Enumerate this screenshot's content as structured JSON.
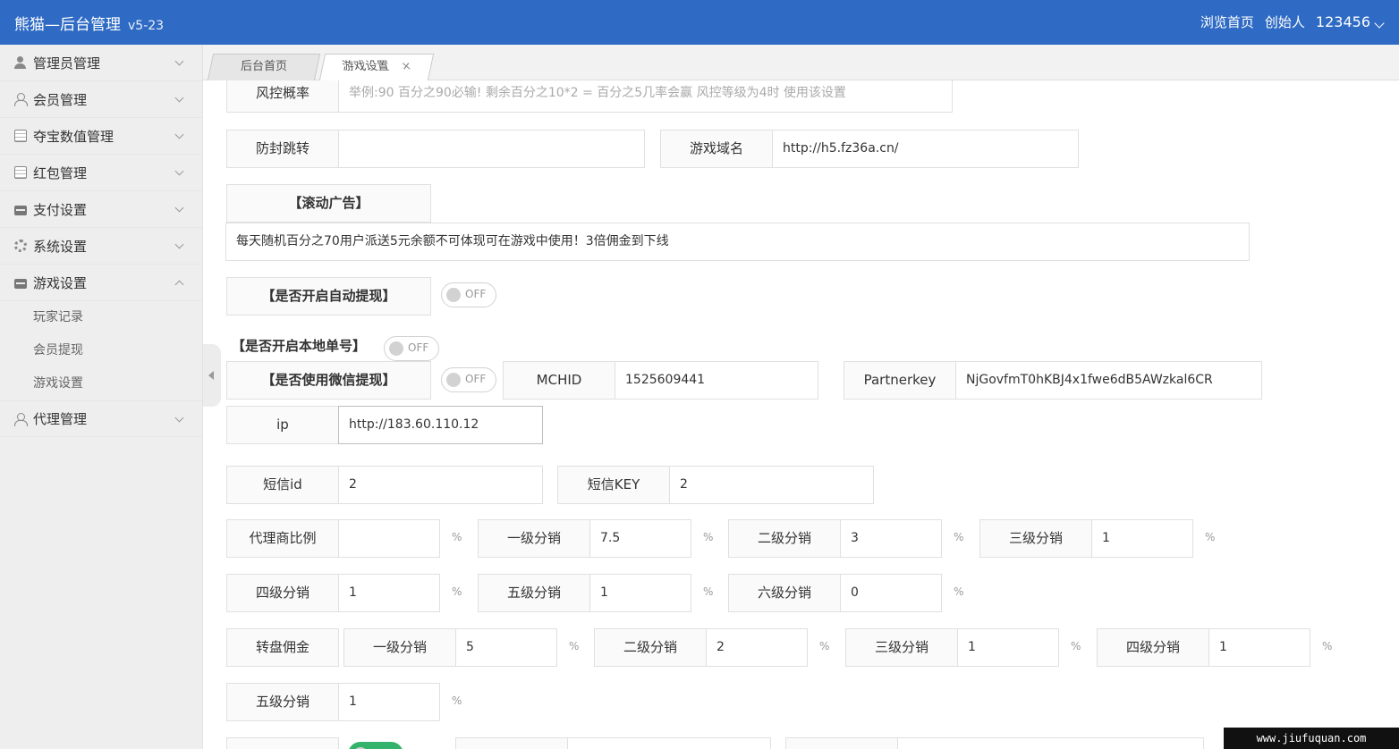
{
  "header": {
    "brand": "熊猫—后台管理",
    "version": "v5-23",
    "links": [
      "浏览首页",
      "创始人",
      "123456"
    ]
  },
  "sidebar": {
    "items": [
      {
        "label": "管理员管理",
        "icon": "user-icon"
      },
      {
        "label": "会员管理",
        "icon": "user-outline-icon"
      },
      {
        "label": "夺宝数值管理",
        "icon": "document-icon"
      },
      {
        "label": "红包管理",
        "icon": "document-icon"
      },
      {
        "label": "支付设置",
        "icon": "card-icon"
      },
      {
        "label": "系统设置",
        "icon": "gear-icon"
      },
      {
        "label": "游戏设置",
        "icon": "card-icon",
        "expanded": true
      }
    ],
    "subitems": [
      "玩家记录",
      "会员提现",
      "游戏设置"
    ],
    "last_item": {
      "label": "代理管理",
      "icon": "user-outline-icon"
    }
  },
  "tabs": [
    {
      "label": "后台首页",
      "active": false
    },
    {
      "label": "游戏设置",
      "active": true,
      "close": "×"
    }
  ],
  "form": {
    "risk_label": "风控概率",
    "risk_placeholder": "举例:90 百分之90必输! 剩余百分之10*2 = 百分之5几率会赢 风控等级为4时 使用该设置",
    "anti_block_label": "防封跳转",
    "anti_block_value": "",
    "game_domain_label": "游戏域名",
    "game_domain_value": "http://h5.fz36a.cn/",
    "scroll_ad_label": "【滚动广告】",
    "scroll_ad_value": "每天随机百分之70用户派送5元余额不可体现可在游戏中使用！3倍佣金到下线",
    "auto_withdraw_label": "【是否开启自动提现】",
    "auto_withdraw_state": "OFF",
    "local_number_label": "【是否开启本地单号】",
    "local_number_state": "OFF",
    "wechat_withdraw_label": "【是否使用微信提现】",
    "wechat_withdraw_state": "OFF",
    "mchid_label": "MCHID",
    "mchid_value": "1525609441",
    "partnerkey_label": "Partnerkey",
    "partnerkey_value": "NjGovfmT0hKBJ4x1fwe6dB5AWzkal6CR",
    "ip_label": "ip",
    "ip_value": "http://183.60.110.12",
    "sms_id_label": "短信id",
    "sms_id_value": "2",
    "sms_key_label": "短信KEY",
    "sms_key_value": "2",
    "percent": "%",
    "agent_ratio_label": "代理商比例",
    "agent_ratio_value": "",
    "level1_label": "一级分销",
    "level1_value": "7.5",
    "level2_label": "二级分销",
    "level2_value": "3",
    "level3_label": "三级分销",
    "level3_value": "1",
    "level4_label": "四级分销",
    "level4_value": "1",
    "level5_label": "五级分销",
    "level5_value": "1",
    "level6_label": "六级分销",
    "level6_value": "0",
    "wheel_label": "转盘佣金",
    "wheel_level1_label": "一级分销",
    "wheel_level1_value": "5",
    "wheel_level2_label": "二级分销",
    "wheel_level2_value": "2",
    "wheel_level3_label": "三级分销",
    "wheel_level3_value": "1",
    "wheel_level4_label": "四级分销",
    "wheel_level4_value": "1",
    "wheel_level5_label": "五级分销",
    "wheel_level5_value": "1"
  },
  "watermark": "www.jiufuquan.com"
}
